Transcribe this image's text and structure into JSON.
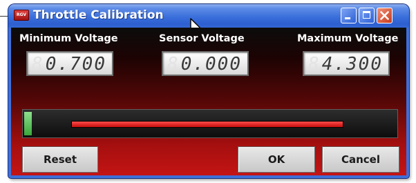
{
  "window": {
    "title": "Throttle Calibration",
    "app_icon_text": "RGV"
  },
  "title_buttons": {
    "minimize": "minimize",
    "maximize": "maximize",
    "close": "close"
  },
  "voltages": {
    "minimum": {
      "label": "Minimum Voltage",
      "display": "0.700",
      "value": 0.7
    },
    "sensor": {
      "label": "Sensor Voltage",
      "display": "0.000",
      "value": 0.0
    },
    "maximum": {
      "label": "Maximum Voltage",
      "display": "4.300",
      "value": 4.3
    }
  },
  "gauge": {
    "fill_fraction": 0.02,
    "range_start_fraction": 0.13,
    "range_end_fraction": 0.86,
    "fill_color": "#3aa83a",
    "range_color": "#d41010"
  },
  "buttons": {
    "reset": "Reset",
    "ok": "OK",
    "cancel": "Cancel"
  },
  "colors": {
    "titlebar": "#2d5fd0",
    "client_top": "#0c0c0c",
    "client_bottom": "#c41414"
  }
}
